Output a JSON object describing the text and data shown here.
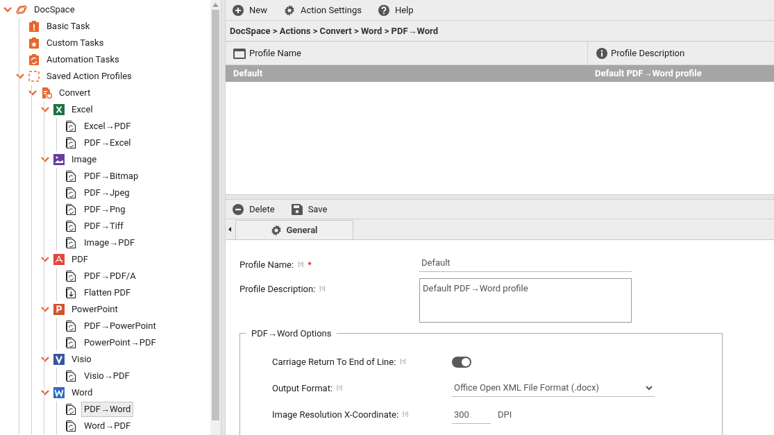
{
  "sidebar": {
    "tree": [
      {
        "label": "DocSpace",
        "kind": "planet",
        "expanded": true,
        "selected": false,
        "children": [
          {
            "label": "Basic Task",
            "kind": "task-alert",
            "selected": false
          },
          {
            "label": "Custom Tasks",
            "kind": "task-star",
            "selected": false
          },
          {
            "label": "Automation Tasks",
            "kind": "task-cycle",
            "selected": false
          },
          {
            "label": "Saved Action Profiles",
            "kind": "profiles",
            "expanded": true,
            "selected": false,
            "children": [
              {
                "label": "Convert",
                "kind": "convert",
                "expanded": true,
                "selected": false,
                "children": [
                  {
                    "label": "Excel",
                    "kind": "excel",
                    "expanded": true,
                    "selected": false,
                    "children": [
                      {
                        "label": "Excel→PDF",
                        "kind": "doc-convert",
                        "selected": false
                      },
                      {
                        "label": "PDF→Excel",
                        "kind": "doc-convert",
                        "selected": false
                      }
                    ]
                  },
                  {
                    "label": "Image",
                    "kind": "image",
                    "expanded": true,
                    "selected": false,
                    "children": [
                      {
                        "label": "PDF→Bitmap",
                        "kind": "doc-convert",
                        "selected": false
                      },
                      {
                        "label": "PDF→Jpeg",
                        "kind": "doc-convert",
                        "selected": false
                      },
                      {
                        "label": "PDF→Png",
                        "kind": "doc-convert",
                        "selected": false
                      },
                      {
                        "label": "PDF→Tiff",
                        "kind": "doc-convert",
                        "selected": false
                      },
                      {
                        "label": "Image→PDF",
                        "kind": "doc-convert",
                        "selected": false
                      }
                    ]
                  },
                  {
                    "label": "PDF",
                    "kind": "pdf",
                    "expanded": true,
                    "selected": false,
                    "children": [
                      {
                        "label": "PDF→PDF/A",
                        "kind": "doc-convert",
                        "selected": false
                      },
                      {
                        "label": "Flatten PDF",
                        "kind": "doc-flatten",
                        "selected": false
                      }
                    ]
                  },
                  {
                    "label": "PowerPoint",
                    "kind": "powerpoint",
                    "expanded": true,
                    "selected": false,
                    "children": [
                      {
                        "label": "PDF→PowerPoint",
                        "kind": "doc-convert",
                        "selected": false
                      },
                      {
                        "label": "PowerPoint→PDF",
                        "kind": "doc-convert",
                        "selected": false
                      }
                    ]
                  },
                  {
                    "label": "Visio",
                    "kind": "visio",
                    "expanded": true,
                    "selected": false,
                    "children": [
                      {
                        "label": "Visio→PDF",
                        "kind": "doc-convert",
                        "selected": false
                      }
                    ]
                  },
                  {
                    "label": "Word",
                    "kind": "word",
                    "expanded": true,
                    "selected": false,
                    "children": [
                      {
                        "label": "PDF→Word",
                        "kind": "doc-convert",
                        "selected": true
                      },
                      {
                        "label": "Word→PDF",
                        "kind": "doc-convert",
                        "selected": false
                      }
                    ]
                  }
                ]
              }
            ]
          }
        ]
      }
    ]
  },
  "toolbar": [
    {
      "label": "New",
      "kind": "plus"
    },
    {
      "label": "Action Settings",
      "kind": "gear"
    },
    {
      "label": "Help",
      "kind": "help"
    }
  ],
  "breadcrumb": "DocSpace > Actions > Convert > Word > PDF→Word",
  "table": {
    "columns": [
      {
        "label": "Profile Name",
        "kind": "window"
      },
      {
        "label": "Profile Description",
        "kind": "info"
      }
    ],
    "rows": [
      {
        "cells": [
          "Default",
          "Default PDF→Word profile"
        ],
        "selected": true
      }
    ]
  },
  "editor_toolbar": [
    {
      "label": "Delete",
      "kind": "minus"
    },
    {
      "label": "Save",
      "kind": "disk"
    }
  ],
  "tabs": [
    {
      "label": "General",
      "selected": true
    }
  ],
  "form": {
    "fields": [
      {
        "kind": "text",
        "label": "Profile Name:",
        "help": "[?]",
        "required_mark": "*",
        "value": "Default"
      },
      {
        "kind": "textarea",
        "label": "Profile Description:",
        "help": "[?]",
        "value": "Default PDF→Word profile"
      }
    ],
    "options": {
      "legend": "PDF→Word Options",
      "fields": [
        {
          "kind": "toggle",
          "label": "Carriage Return To End of Line:",
          "help": "[?]",
          "on": true
        },
        {
          "kind": "select",
          "label": "Output Format:",
          "help": "[?]",
          "value": "Office Open XML File Format (.docx)"
        },
        {
          "kind": "number",
          "label": "Image Resolution X-Coordinate:",
          "help": "[?]",
          "value": "300",
          "unit": "DPI"
        }
      ]
    }
  }
}
